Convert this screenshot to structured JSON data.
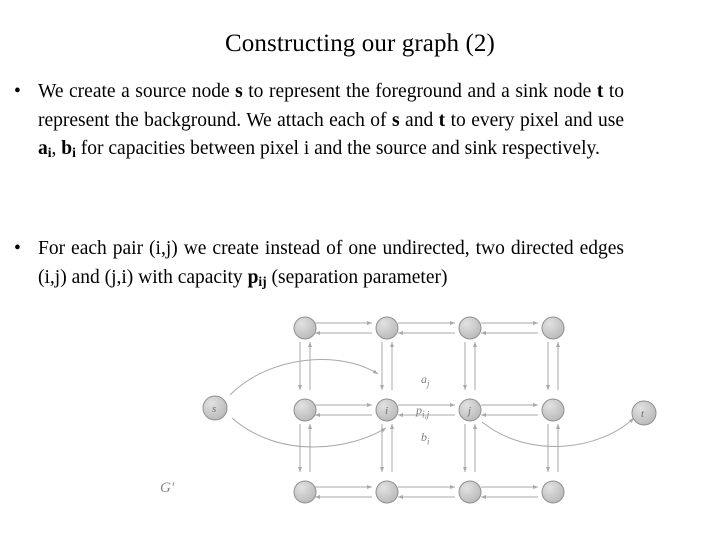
{
  "slide": {
    "title": "Constructing our graph (2)",
    "bullets": [
      {
        "marker": "•",
        "segments": [
          {
            "text": "We create a source node ",
            "style": "normal"
          },
          {
            "text": "s",
            "style": "bold"
          },
          {
            "text": " to represent the foreground and a sink node ",
            "style": "normal"
          },
          {
            "text": "t",
            "style": "bold"
          },
          {
            "text": " to represent the background. We attach each of ",
            "style": "normal"
          },
          {
            "text": "s",
            "style": "bold"
          },
          {
            "text": " and ",
            "style": "normal"
          },
          {
            "text": "t",
            "style": "bold"
          },
          {
            "text": " to every pixel and use ",
            "style": "normal"
          },
          {
            "text": "a",
            "style": "bold"
          },
          {
            "text": "i",
            "style": "sub"
          },
          {
            "text": ", ",
            "style": "normal"
          },
          {
            "text": "b",
            "style": "bold"
          },
          {
            "text": "i",
            "style": "sub"
          },
          {
            "text": " for capacities between pixel i and the source and sink respectively.",
            "style": "normal"
          }
        ]
      },
      {
        "marker": "•",
        "segments": [
          {
            "text": "For each pair (i,j) we create instead of one undirected, two directed edges (i,j) and (j,i) with capacity ",
            "style": "normal"
          },
          {
            "text": "p",
            "style": "bold"
          },
          {
            "text": "ij",
            "style": "sub"
          },
          {
            "text": " (separation parameter)",
            "style": "normal"
          }
        ]
      }
    ]
  },
  "figure": {
    "name": "graph-diagram",
    "source_label": "s",
    "sink_label": "t",
    "node_i_label": "i",
    "node_j_label": "j",
    "edge_capacity_label": "p",
    "edge_capacity_sub": "i,j",
    "source_capacity_label": "a",
    "source_capacity_sub": "j",
    "sink_capacity_label": "b",
    "sink_capacity_sub": "i",
    "graph_name": "G'",
    "node_color": "#c0c0c0",
    "node_stroke": "#808080",
    "edge_color": "#a0a0a0",
    "grid_columns": 4,
    "grid_rows": 3
  }
}
